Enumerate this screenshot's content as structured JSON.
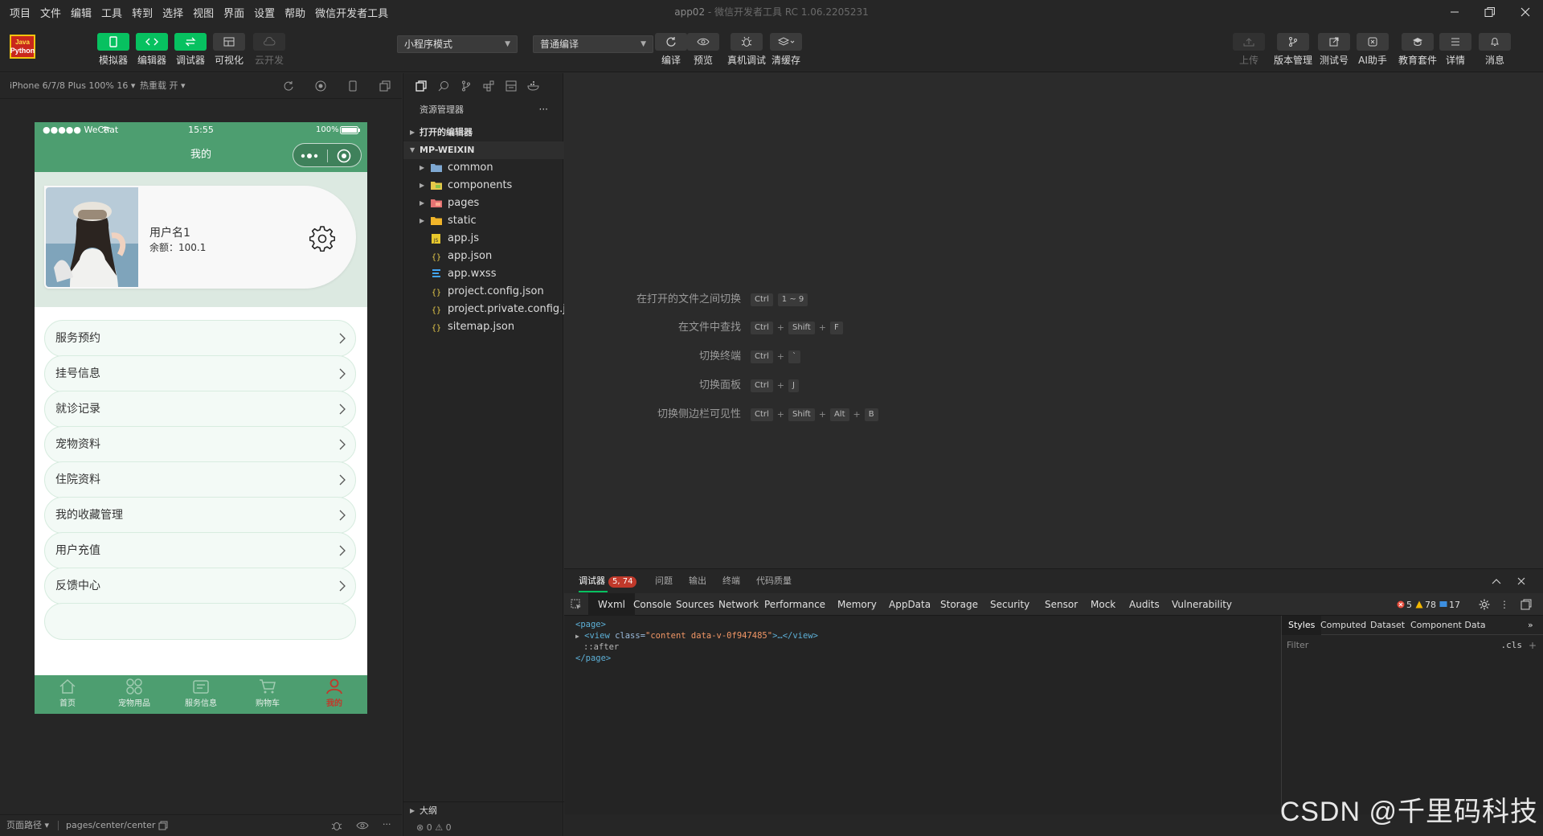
{
  "menubar": {
    "items": [
      "项目",
      "文件",
      "编辑",
      "工具",
      "转到",
      "选择",
      "视图",
      "界面",
      "设置",
      "帮助",
      "微信开发者工具"
    ]
  },
  "window": {
    "project": "app02",
    "product": "微信开发者工具 RC 1.06.2205231",
    "separator": " - "
  },
  "logo": {
    "line1": "Java",
    "line2": "Python"
  },
  "toolbar": {
    "simulator": "模拟器",
    "editor": "编辑器",
    "debugger": "调试器",
    "visual": "可视化",
    "cloud": "云开发",
    "mode_select": "小程序模式",
    "compile_select": "普通编译",
    "compile": "编译",
    "preview": "预览",
    "remote_debug": "真机调试",
    "clear_cache": "清缓存",
    "upload": "上传",
    "version": "版本管理",
    "test": "测试号",
    "ai": "AI助手",
    "edu": "教育套件",
    "detail": "详情",
    "msg": "消息"
  },
  "simulator": {
    "device": "iPhone 6/7/8 Plus 100% 16 ▾",
    "hot_reload": "热重载 开 ▾"
  },
  "phone": {
    "status_left": "●●●●● WeChat",
    "status_time": "15:55",
    "status_right": "100%",
    "nav_title": "我的",
    "username": "用户名1",
    "balance": "余额：100.1",
    "menu": [
      "服务预约",
      "挂号信息",
      "就诊记录",
      "宠物资料",
      "住院资料",
      "我的收藏管理",
      "用户充值",
      "反馈中心"
    ],
    "tabs": [
      "首页",
      "宠物用品",
      "服务信息",
      "购物车",
      "我的"
    ]
  },
  "sim_footer": {
    "path_label": "页面路径 ▾",
    "path": "pages/center/center"
  },
  "explorer": {
    "title": "资源管理器",
    "more": "···",
    "open_editors": "打开的编辑器",
    "root": "MP-WEIXIN",
    "files": [
      {
        "name": "common",
        "type": "folder-blue"
      },
      {
        "name": "components",
        "type": "folder-yellow"
      },
      {
        "name": "pages",
        "type": "folder-red"
      },
      {
        "name": "static",
        "type": "folder-orange"
      },
      {
        "name": "app.js",
        "type": "js"
      },
      {
        "name": "app.json",
        "type": "json"
      },
      {
        "name": "app.wxss",
        "type": "css"
      },
      {
        "name": "project.config.json",
        "type": "json"
      },
      {
        "name": "project.private.config.js...",
        "type": "json"
      },
      {
        "name": "sitemap.json",
        "type": "json"
      }
    ],
    "outline": "大纲",
    "footer": "⊗ 0 ⚠ 0"
  },
  "shortcuts": [
    {
      "label": "在打开的文件之间切换",
      "keys": [
        "Ctrl",
        "1 ~ 9"
      ]
    },
    {
      "label": "在文件中查找",
      "keys": [
        "Ctrl",
        "+",
        "Shift",
        "+",
        "F"
      ]
    },
    {
      "label": "切换终端",
      "keys": [
        "Ctrl",
        "+",
        "`"
      ]
    },
    {
      "label": "切换面板",
      "keys": [
        "Ctrl",
        "+",
        "J"
      ]
    },
    {
      "label": "切换侧边栏可见性",
      "keys": [
        "Ctrl",
        "+",
        "Shift",
        "+",
        "Alt",
        "+",
        "B"
      ]
    }
  ],
  "devtools": {
    "top_tabs": [
      "调试器",
      "问题",
      "输出",
      "终端",
      "代码质量"
    ],
    "badge": "5, 74",
    "tabs": [
      "Wxml",
      "Console",
      "Sources",
      "Network",
      "Performance",
      "Memory",
      "AppData",
      "Storage",
      "Security",
      "Sensor",
      "Mock",
      "Audits",
      "Vulnerability"
    ],
    "errors": "5",
    "warnings": "78",
    "infos": "17",
    "code": {
      "page_open": "<page>",
      "view_tag": "<view",
      "attr_name": " class=",
      "attr_value": "\"content data-v-0f947485\"",
      "view_close": ">…</view>",
      "after": "::after",
      "page_close": "</page>"
    },
    "side_tabs": [
      "Styles",
      "Computed",
      "Dataset",
      "Component Data"
    ],
    "filter": "Filter",
    "cls": ".cls"
  },
  "watermark": "CSDN @千里码科技"
}
